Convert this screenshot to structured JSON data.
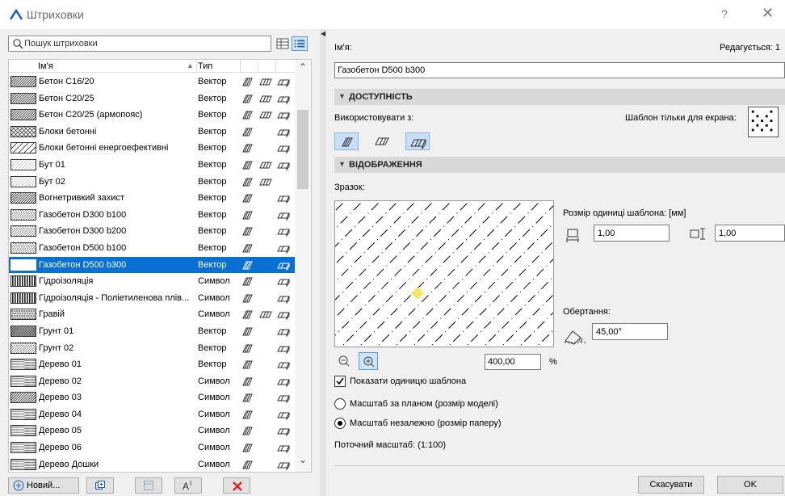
{
  "window": {
    "title": "Штриховки",
    "help": "?",
    "close": "✕"
  },
  "search": {
    "placeholder": "Пошук штриховки"
  },
  "list": {
    "col_name": "Ім'я",
    "col_type": "Тип",
    "sort_indicator": "▲",
    "rows": [
      {
        "name": "Бетон С16/20",
        "type": "Вектор",
        "pattern": "diag"
      },
      {
        "name": "Бетон С20/25",
        "type": "Вектор",
        "pattern": "diag"
      },
      {
        "name": "Бетон С20/25 (армопояс)",
        "type": "Вектор",
        "pattern": "diag"
      },
      {
        "name": "Блоки бетонні",
        "type": "Вектор",
        "pattern": "cross"
      },
      {
        "name": "Блоки бетонні енергоефективні",
        "type": "Вектор",
        "pattern": "diag-sparse"
      },
      {
        "name": "Бут 01",
        "type": "Вектор",
        "pattern": "stone"
      },
      {
        "name": "Бут 02",
        "type": "Вектор",
        "pattern": "stone"
      },
      {
        "name": "Вогнетривкий захист",
        "type": "Вектор",
        "pattern": "diag"
      },
      {
        "name": "Газобетон D300 b100",
        "type": "Вектор",
        "pattern": "dashdiag"
      },
      {
        "name": "Газобетон D300 b200",
        "type": "Вектор",
        "pattern": "dashdiag"
      },
      {
        "name": "Газобетон D500 b100",
        "type": "Вектор",
        "pattern": "dashdiag"
      },
      {
        "name": "Газобетон D500 b300",
        "type": "Вектор",
        "pattern": "dashdiag",
        "selected": true
      },
      {
        "name": "Гідроізоляція",
        "type": "Символ",
        "pattern": "vertical"
      },
      {
        "name": "Гідроізоляція - Поліетиленова плів...",
        "type": "Символ",
        "pattern": "vertical"
      },
      {
        "name": "Гравій",
        "type": "Символ",
        "pattern": "gravel"
      },
      {
        "name": "Грунт 01",
        "type": "Вектор",
        "pattern": "diag-dense"
      },
      {
        "name": "Грунт 02",
        "type": "Вектор",
        "pattern": "dashdiag"
      },
      {
        "name": "Дерево 01",
        "type": "Вектор",
        "pattern": "wood"
      },
      {
        "name": "Дерево 02",
        "type": "Символ",
        "pattern": "wood"
      },
      {
        "name": "Дерево 03",
        "type": "Символ",
        "pattern": "diag"
      },
      {
        "name": "Дерево 04",
        "type": "Символ",
        "pattern": "wood"
      },
      {
        "name": "Дерево 05",
        "type": "Символ",
        "pattern": "wood"
      },
      {
        "name": "Дерево 06",
        "type": "Символ",
        "pattern": "wood"
      },
      {
        "name": "Дерево Дошки",
        "type": "Символ",
        "pattern": "wood"
      }
    ]
  },
  "bottom": {
    "new_label": "Новий..."
  },
  "details": {
    "name_label": "Ім'я:",
    "editing": "Редагується: 1",
    "name_value": "Газобетон D500 b300",
    "section_availability": "ДОСТУПНІСТЬ",
    "use_with": "Використовувати з:",
    "screen_only": "Шаблон тільки для екрана:",
    "section_display": "ВІДОБРАЖЕННЯ",
    "sample": "Зразок:",
    "zoom_value": "400,00",
    "zoom_unit": "%",
    "unit_size": "Розмір одиниці шаблона: [мм]",
    "unit_width": "1,00",
    "unit_height": "1,00",
    "rotation_label": "Обертання:",
    "rotation_value": "45,00°",
    "show_unit": "Показати одиницю шаблона",
    "scale_plan": "Масштаб за планом (розмір моделі)",
    "scale_independent": "Масштаб незалежно (розмір паперу)",
    "current_scale": "Поточний масштаб: (1:100)"
  },
  "buttons": {
    "cancel": "Скасувати",
    "ok": "OK"
  },
  "colors": {
    "selection": "#0a6fd3",
    "accent": "#5b9bd5",
    "section_bg": "#d9d9d9",
    "marker": "#f5e663"
  }
}
